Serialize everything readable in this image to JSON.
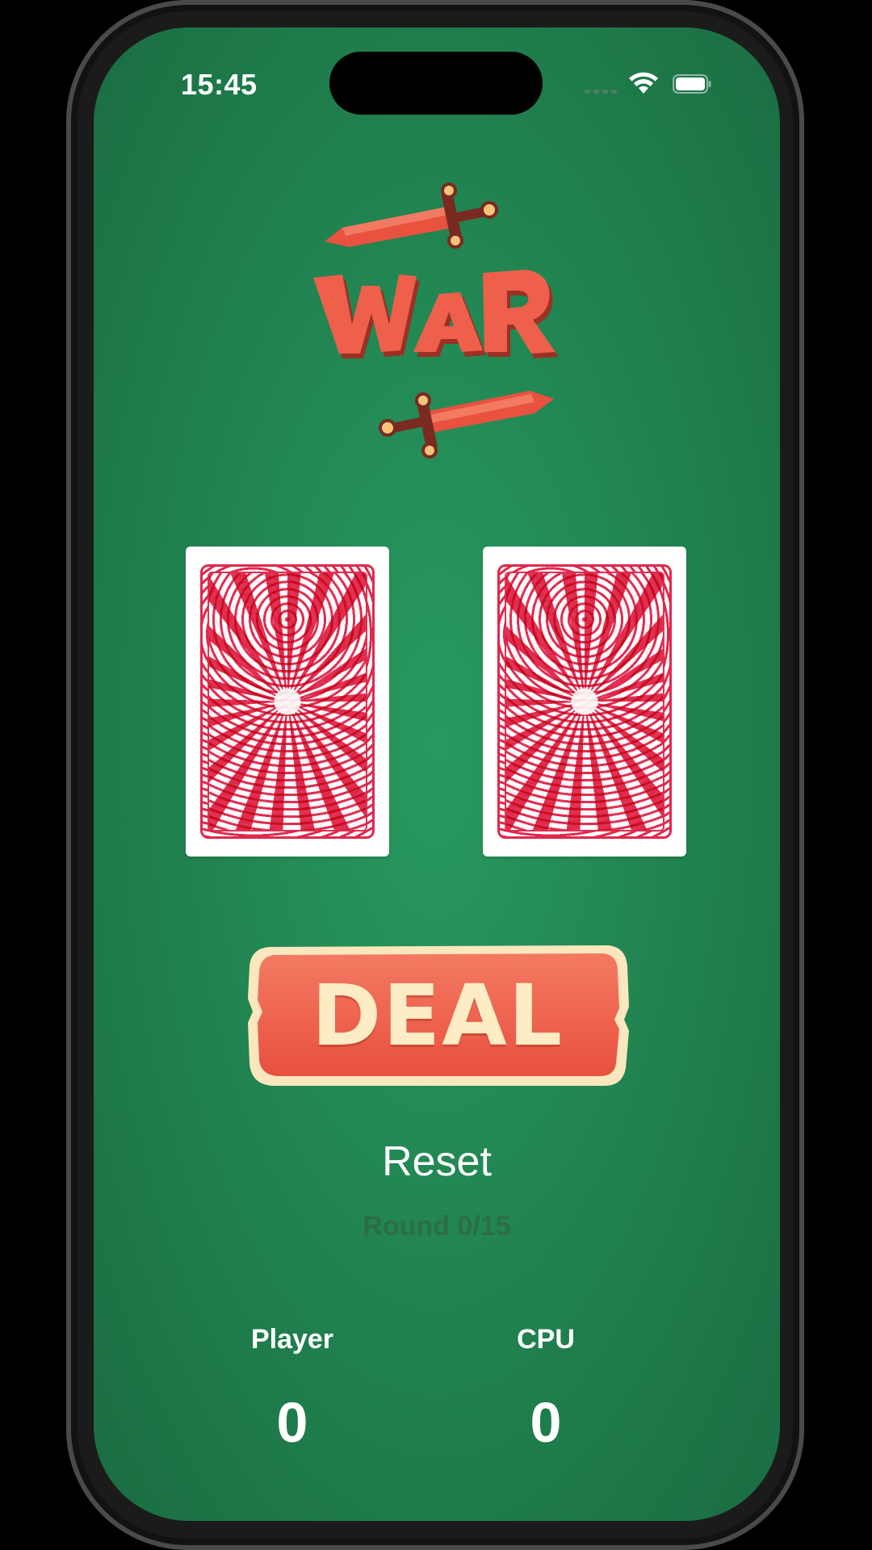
{
  "status_bar": {
    "time": "15:45",
    "icons": [
      "signal-icon",
      "wifi-icon",
      "battery-icon"
    ]
  },
  "logo": {
    "text": "WAR",
    "icons": [
      "sword-icon",
      "sword-icon"
    ]
  },
  "cards": [
    {
      "name": "player-card",
      "face": "back"
    },
    {
      "name": "cpu-card",
      "face": "back"
    }
  ],
  "controls": {
    "deal_label": "DEAL",
    "reset_label": "Reset"
  },
  "round": {
    "label": "Round 0/15"
  },
  "scores": {
    "player_title": "Player",
    "player_score": "0",
    "cpu_title": "CPU",
    "cpu_score": "0"
  },
  "colors": {
    "felt_green": "#238a55",
    "deal_red": "#ee5f4c",
    "deal_cream": "#fdecc4",
    "card_red": "#e0284c"
  }
}
